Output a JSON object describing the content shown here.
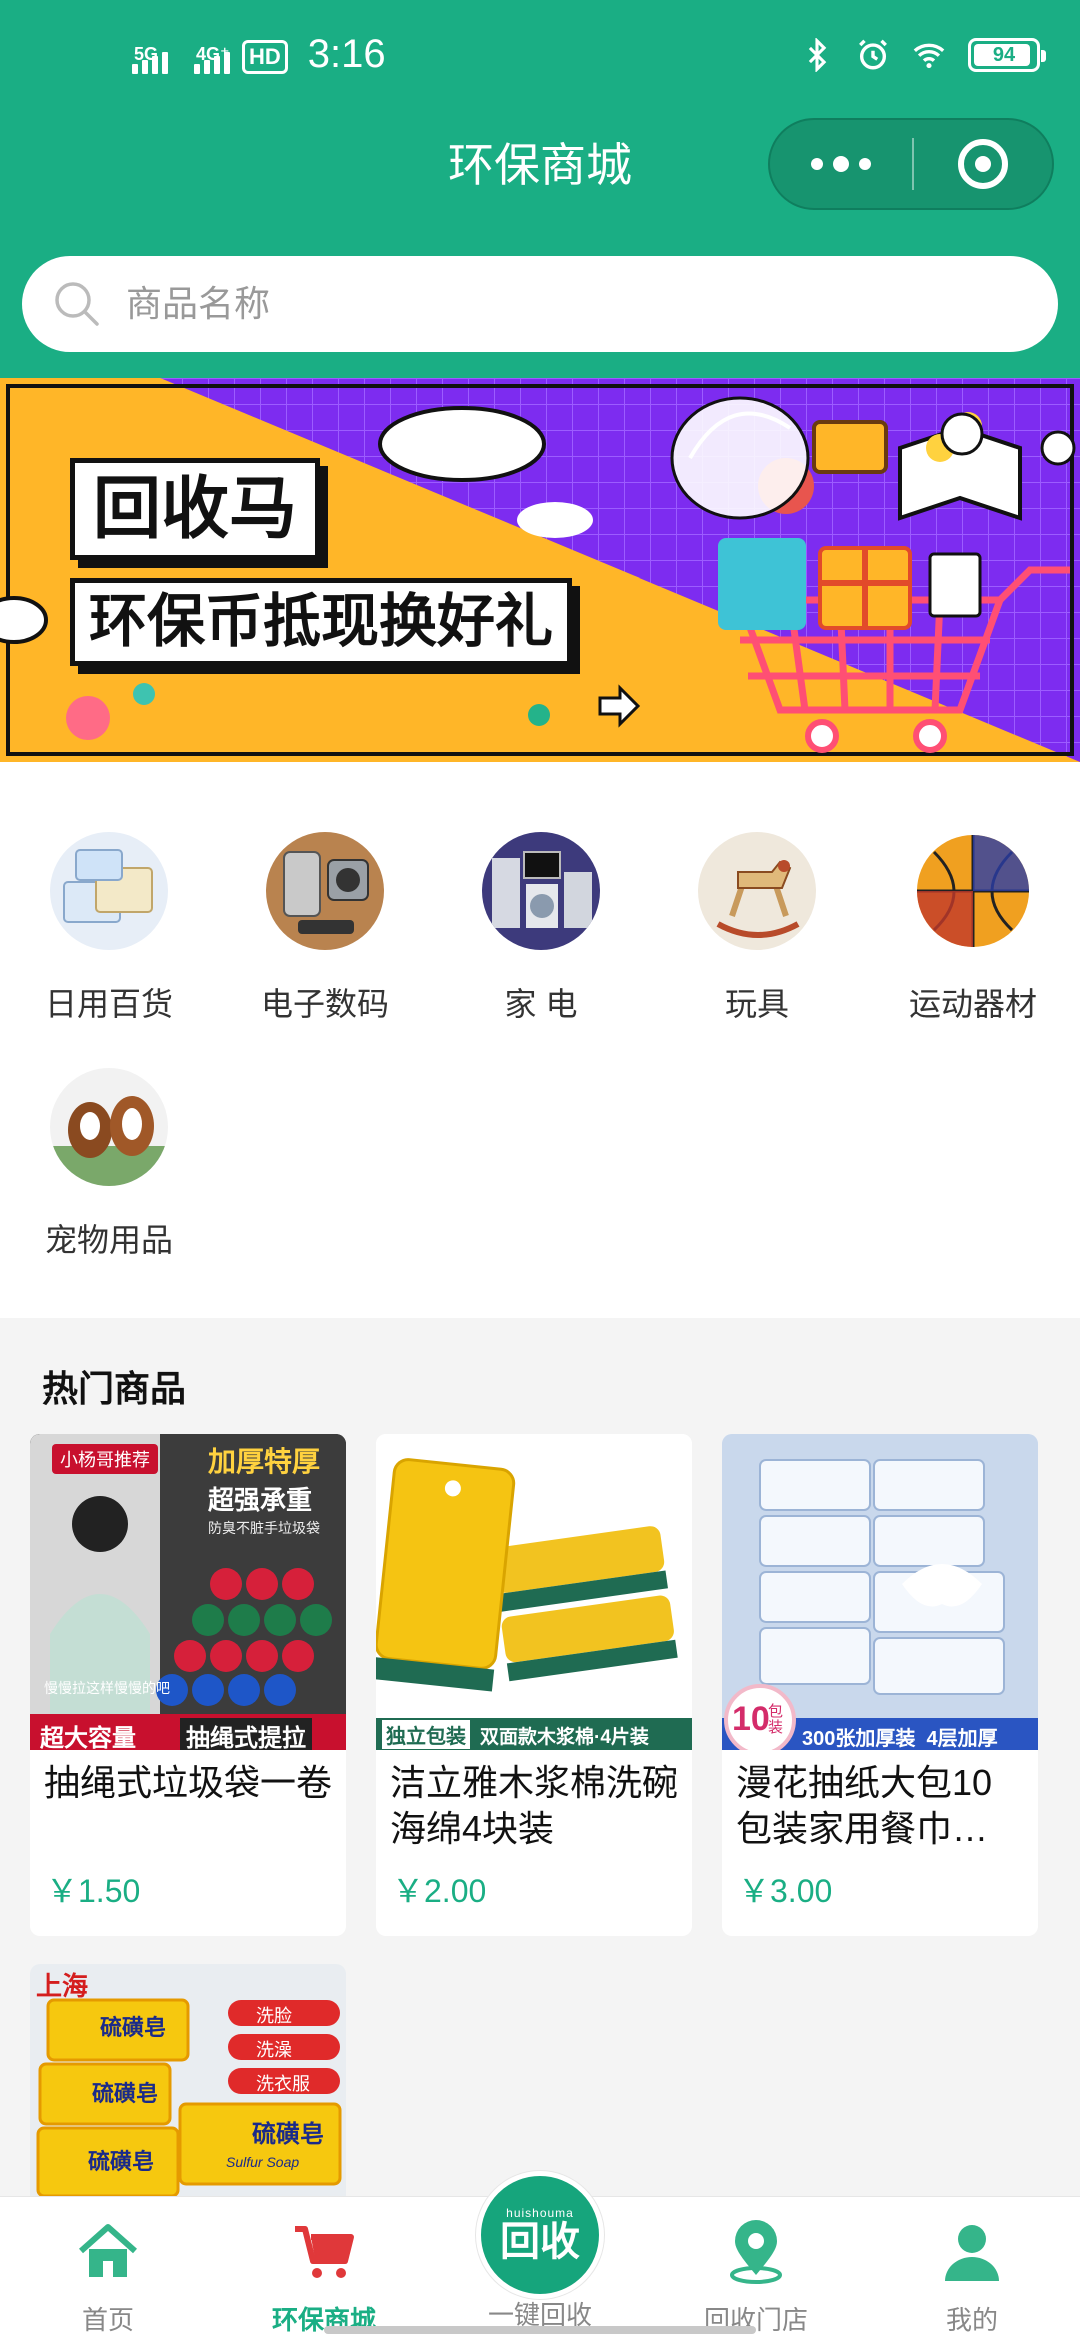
{
  "status_bar": {
    "network1": "5G",
    "network2": "4G⁺",
    "hd": "HD",
    "time": "3:16",
    "battery": "94",
    "battery_level": 0.94
  },
  "nav": {
    "title": "环保商城"
  },
  "search": {
    "placeholder": "商品名称"
  },
  "banner": {
    "line1": "回收马",
    "line2": "环保币抵现换好礼"
  },
  "categories": [
    {
      "label": "日用百货",
      "icon": "tissue-pack"
    },
    {
      "label": "电子数码",
      "icon": "phone-accessories"
    },
    {
      "label": "家 电",
      "icon": "home-appliances"
    },
    {
      "label": "玩具",
      "icon": "rocking-horse"
    },
    {
      "label": "运动器材",
      "icon": "basketball"
    },
    {
      "label": "宠物用品",
      "icon": "dogs"
    }
  ],
  "hot": {
    "title": "热门商品",
    "items": [
      {
        "name": "抽绳式垃圾袋一卷",
        "price": "￥1.50",
        "img_text": {
          "badge": "小杨哥推荐",
          "t1": "加厚特厚",
          "t2": "超强承重",
          "t3": "防臭不脏手垃圾袋",
          "t4": "慢慢拉这样慢慢的吧",
          "b1": "超大容量",
          "b2": "抽绳式提拉"
        }
      },
      {
        "name": "洁立雅木浆棉洗碗海绵4块装",
        "price": "￥2.00",
        "img_text": {
          "b1": "独立包装",
          "b2": "双面款木浆棉·4片装"
        }
      },
      {
        "name": "漫花抽纸大包10包装家用餐巾…",
        "price": "￥3.00",
        "img_text": {
          "n": "10",
          "u": "包装",
          "b": "300张加厚装  4层加厚"
        }
      },
      {
        "name": "",
        "price": "",
        "img_text": {
          "brand": "上海",
          "soap": "硫磺皂",
          "c1": "洗脸",
          "c2": "洗澡",
          "c3": "洗衣服",
          "en": "Sulfur Soap"
        }
      }
    ]
  },
  "tabbar": {
    "tabs": [
      {
        "label": "首页",
        "icon": "home-icon"
      },
      {
        "label": "环保商城",
        "icon": "cart-icon",
        "active": true
      },
      {
        "label": "一键回收",
        "icon": "recycle-logo"
      },
      {
        "label": "回收门店",
        "icon": "location-icon"
      },
      {
        "label": "我的",
        "icon": "user-icon"
      }
    ],
    "fab": {
      "brand": "huishouma",
      "text": "回收"
    }
  },
  "colors": {
    "primary": "#1aae84",
    "banner_purple": "#7d2cf0",
    "banner_yellow": "#ffb628"
  }
}
